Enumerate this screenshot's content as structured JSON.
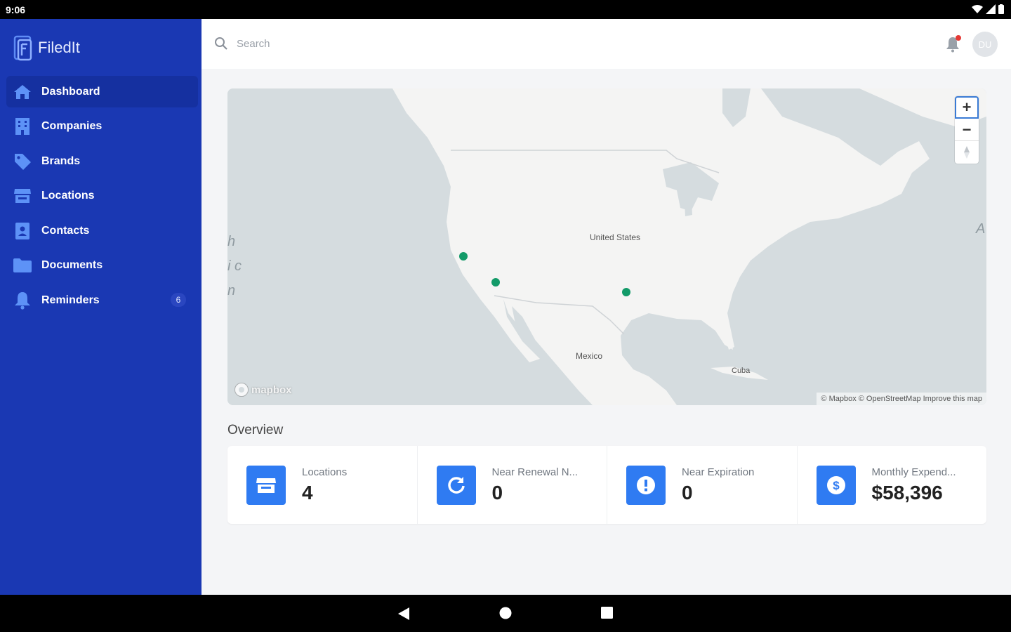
{
  "status_bar": {
    "time": "9:06"
  },
  "sidebar": {
    "brand": "FiledIt",
    "items": [
      {
        "label": "Dashboard",
        "icon": "home-icon",
        "active": true
      },
      {
        "label": "Companies",
        "icon": "building-icon"
      },
      {
        "label": "Brands",
        "icon": "tag-icon"
      },
      {
        "label": "Locations",
        "icon": "store-icon"
      },
      {
        "label": "Contacts",
        "icon": "contact-card-icon"
      },
      {
        "label": "Documents",
        "icon": "folder-icon"
      },
      {
        "label": "Reminders",
        "icon": "bell-icon",
        "badge": "6"
      }
    ]
  },
  "header": {
    "search_placeholder": "Search",
    "avatar_initials": "DU"
  },
  "map": {
    "labels": {
      "us": "United States",
      "mexico": "Mexico",
      "cuba": "Cuba"
    },
    "edge_letters": [
      "h",
      "i c",
      "n"
    ],
    "edge_letter_right": "A",
    "logo": "mapbox",
    "attribution": "© Mapbox © OpenStreetMap Improve this map",
    "controls": {
      "zoom_in": "+",
      "zoom_out": "−"
    },
    "marker_color": "#129a68"
  },
  "overview": {
    "title": "Overview",
    "cards": [
      {
        "label": "Locations",
        "value": "4",
        "icon": "store-icon"
      },
      {
        "label": "Near Renewal N...",
        "value": "0",
        "icon": "refresh-icon"
      },
      {
        "label": "Near Expiration",
        "value": "0",
        "icon": "alert-circle-icon"
      },
      {
        "label": "Monthly Expend...",
        "value": "$58,396",
        "icon": "dollar-icon"
      }
    ]
  },
  "colors": {
    "sidebar": "#1a38b3",
    "accent": "#2f7bf2",
    "map_water": "#d5dcdf",
    "map_land": "#f4f4f3"
  }
}
